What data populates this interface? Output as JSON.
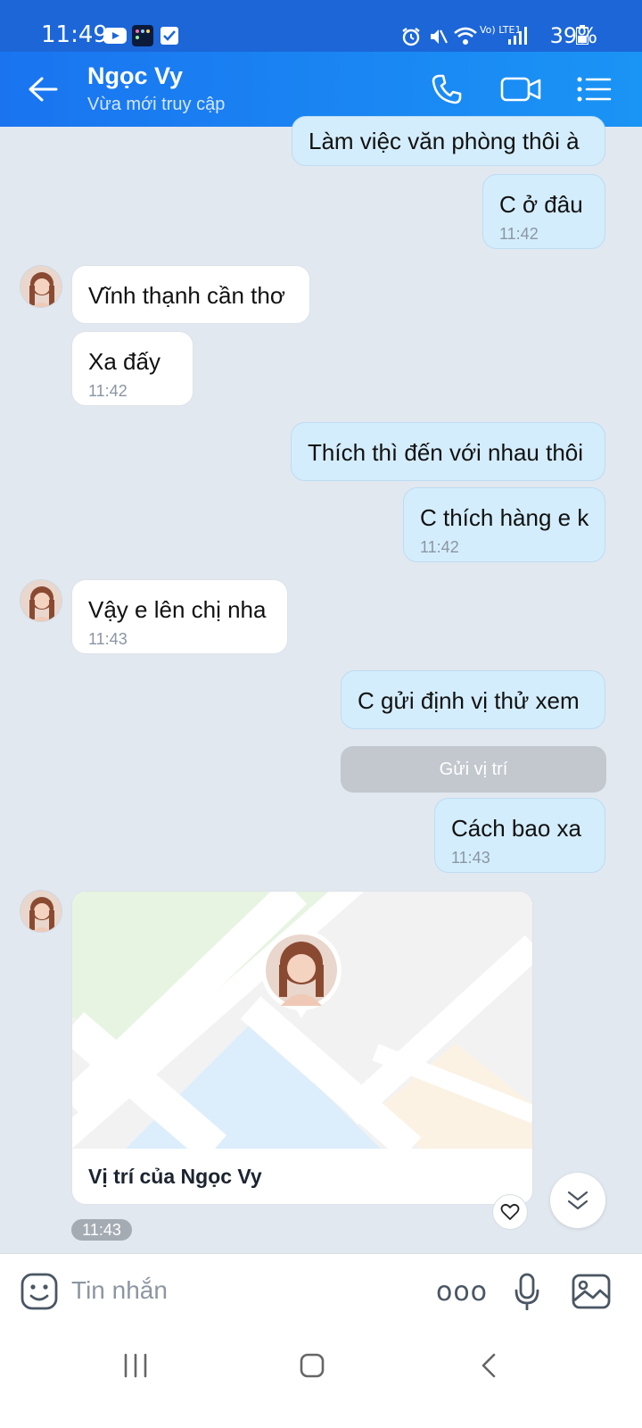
{
  "status_bar": {
    "time": "11:49",
    "battery": "39%",
    "network": "Vo) LTE1"
  },
  "header": {
    "contact_name": "Ngọc Vy",
    "contact_status": "Vừa mới truy cập"
  },
  "messages": [
    {
      "direction": "out",
      "text": "Làm việc văn phòng thôi à",
      "time": ""
    },
    {
      "direction": "out",
      "text": "C ở đâu",
      "time": "11:42"
    },
    {
      "direction": "in",
      "text": "Vĩnh thạnh cần thơ",
      "time": ""
    },
    {
      "direction": "in",
      "text": "Xa đấy",
      "time": "11:42"
    },
    {
      "direction": "out",
      "text": "Thích thì đến với nhau thôi",
      "time": ""
    },
    {
      "direction": "out",
      "text": "C thích hàng e k",
      "time": "11:42"
    },
    {
      "direction": "in",
      "text": "Vậy e lên chị nha",
      "time": "11:43"
    },
    {
      "direction": "out",
      "text": "C gửi định vị thử xem",
      "time": ""
    },
    {
      "direction": "out",
      "text": "Cách bao xa",
      "time": "11:43"
    }
  ],
  "send_location_button": "Gửi vị trí",
  "location_card": {
    "label": "Vị trí của Ngọc Vy",
    "time": "11:43"
  },
  "input": {
    "placeholder": "Tin nhắn",
    "more_label": "ooo"
  },
  "colors": {
    "header": "#1a80f2",
    "outgoing_bubble": "#d4edfc",
    "incoming_bubble": "#ffffff",
    "background": "#e2e8f0"
  }
}
